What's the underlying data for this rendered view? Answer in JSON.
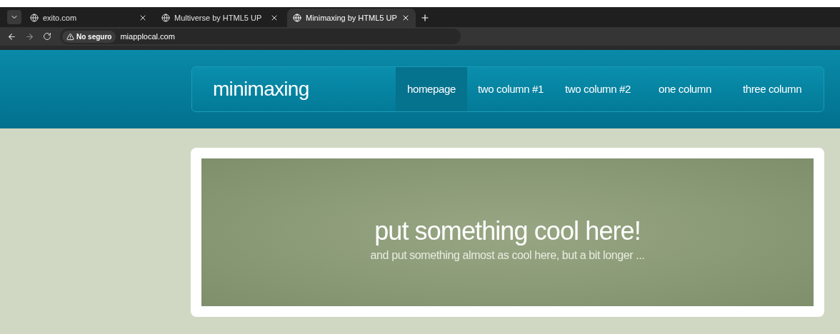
{
  "browser": {
    "tabs": [
      {
        "title": "exito.com",
        "selected": false
      },
      {
        "title": "Multiverse by HTML5 UP",
        "selected": false
      },
      {
        "title": "Minimaxing by HTML5 UP",
        "selected": true
      }
    ],
    "security": "No seguro",
    "url": "miapplocal.com"
  },
  "site": {
    "logo": "minimaxing",
    "nav": [
      {
        "label": "homepage",
        "selected": true
      },
      {
        "label": "two column #1",
        "selected": false
      },
      {
        "label": "two column #2",
        "selected": false
      },
      {
        "label": "one column",
        "selected": false
      },
      {
        "label": "three column",
        "selected": false
      }
    ]
  },
  "banner": {
    "title": "put something cool here!",
    "subtitle": "and put something almost as cool here, but a bit longer ..."
  }
}
